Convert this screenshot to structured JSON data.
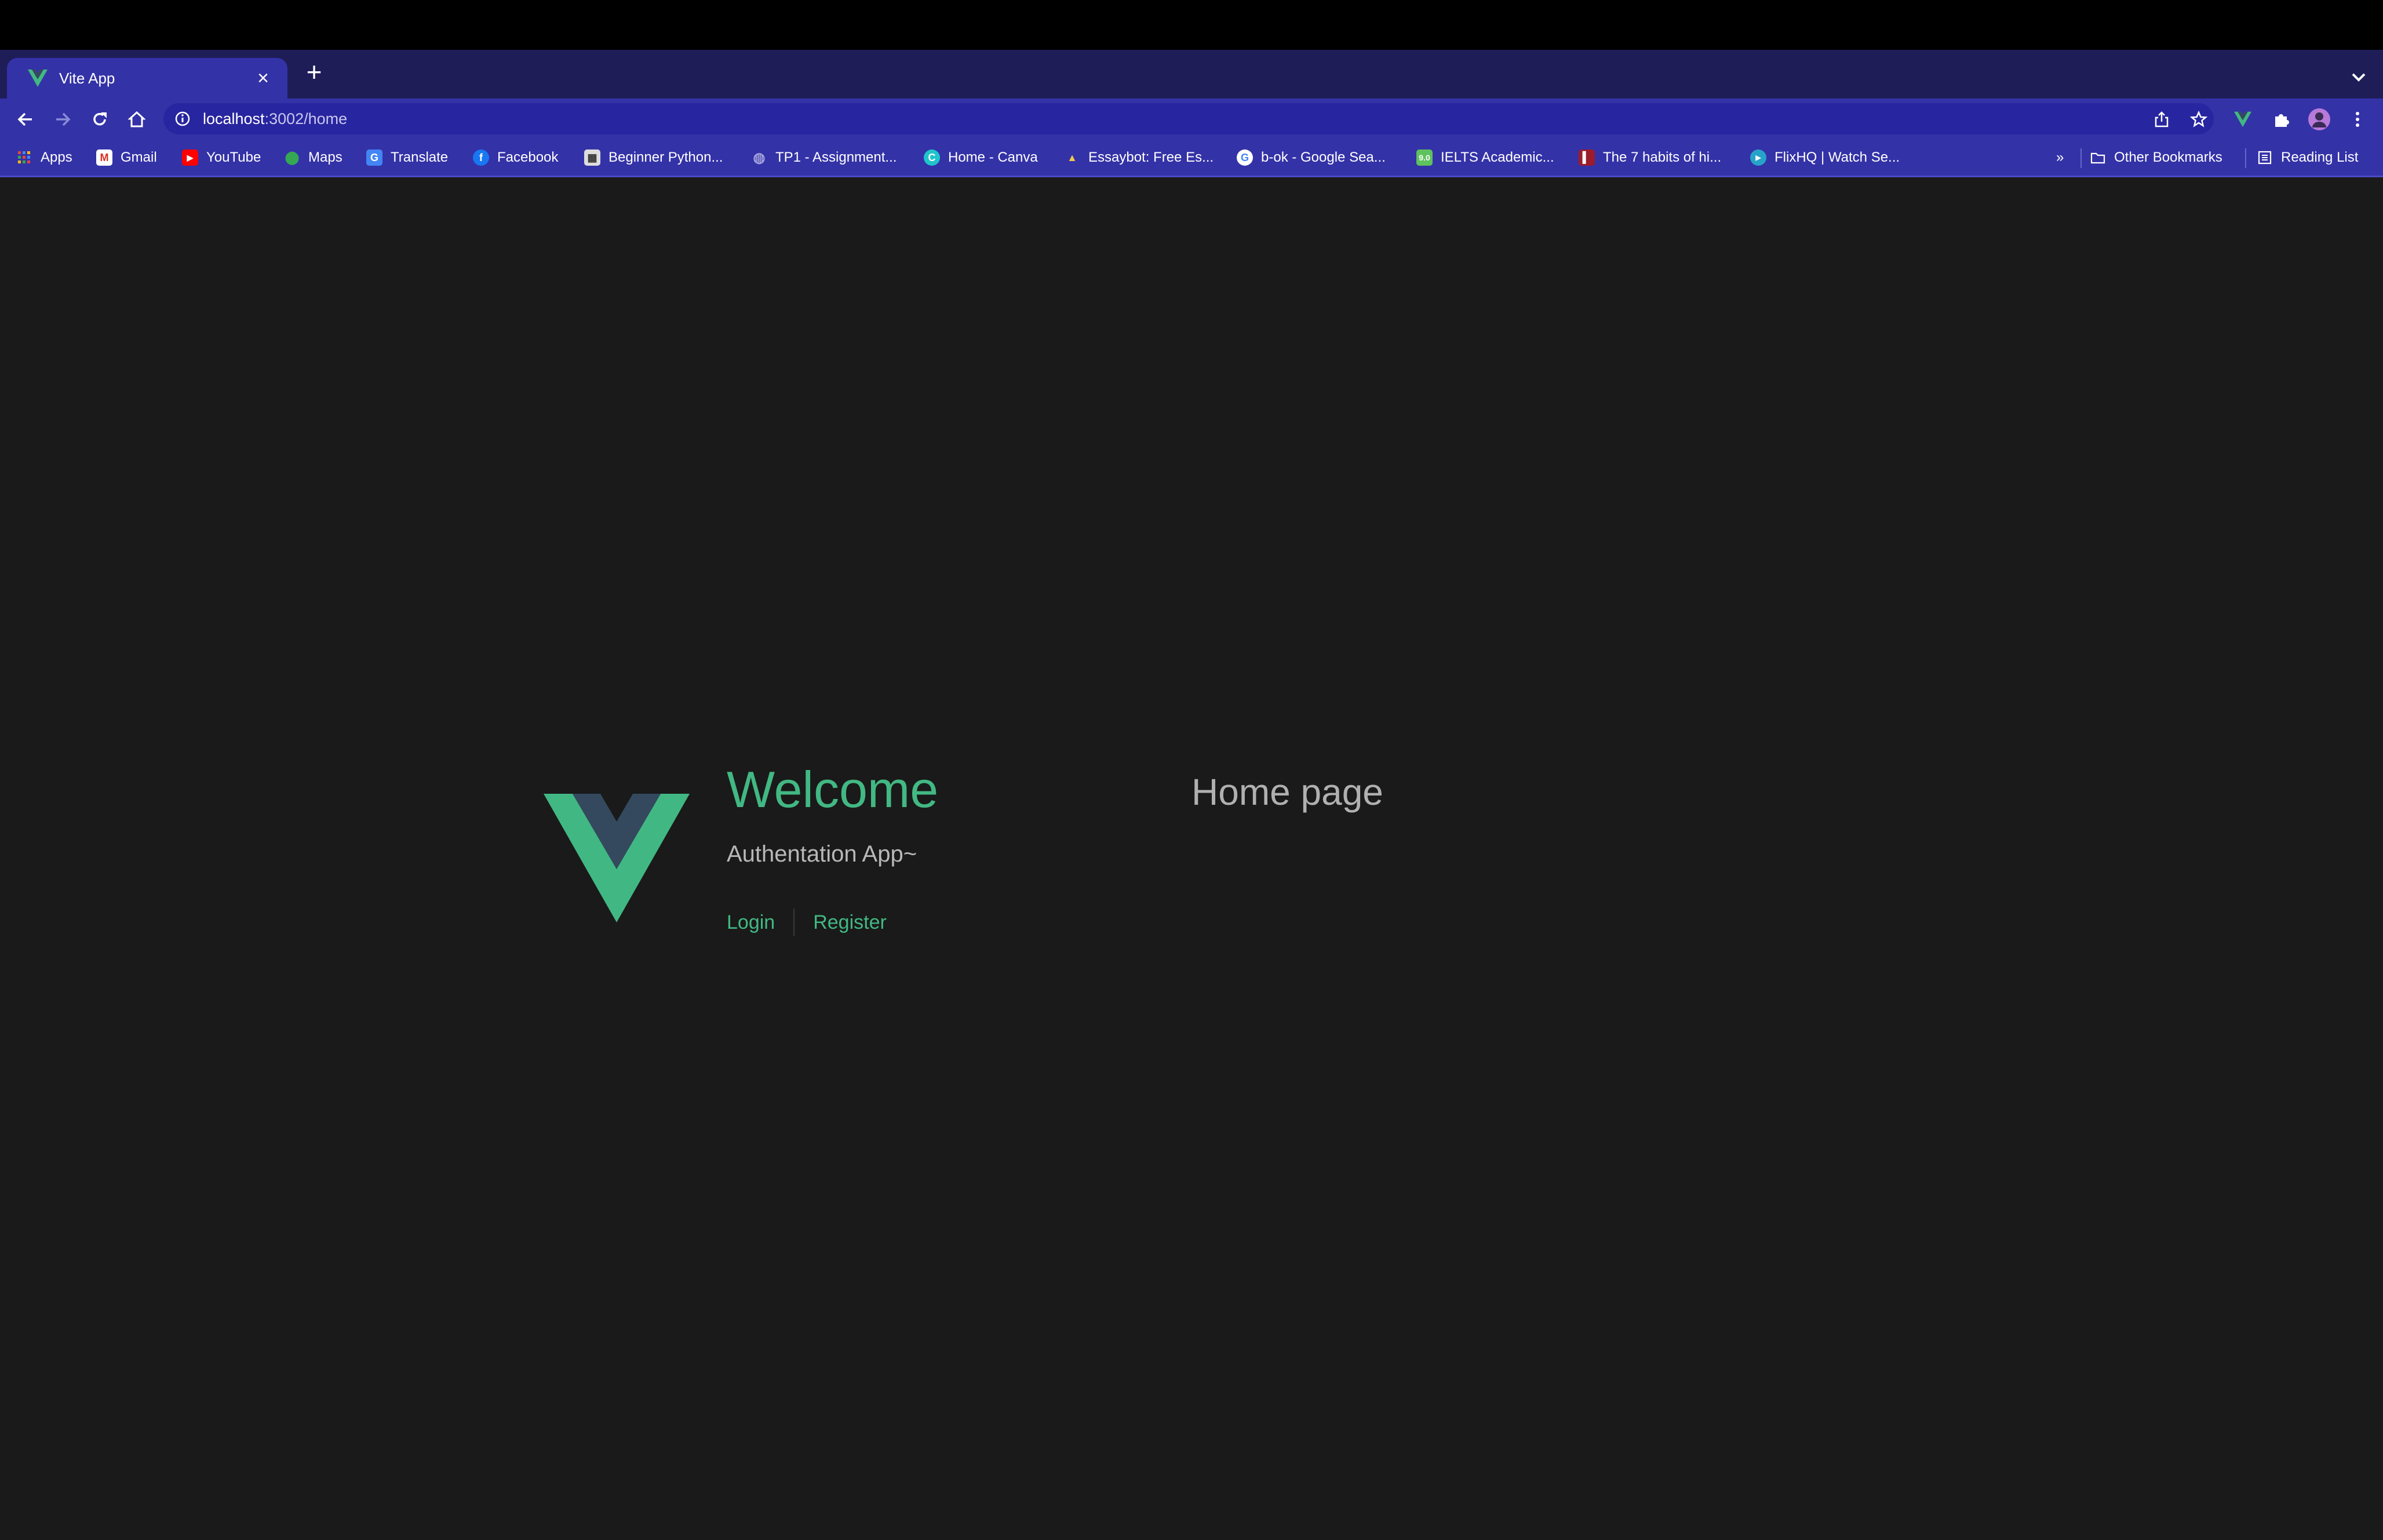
{
  "browser": {
    "tab_title": "Vite App",
    "tab_close": "×",
    "new_tab": "+",
    "url_host": "localhost",
    "url_rest": ":3002/home",
    "bookmarks": [
      {
        "label": "Apps",
        "icon": "apps-grid-icon"
      },
      {
        "label": "Gmail",
        "icon": "gmail-icon"
      },
      {
        "label": "YouTube",
        "icon": "youtube-icon"
      },
      {
        "label": "Maps",
        "icon": "maps-icon"
      },
      {
        "label": "Translate",
        "icon": "translate-icon"
      },
      {
        "label": "Facebook",
        "icon": "facebook-icon"
      },
      {
        "label": "Beginner Python...",
        "icon": "python-icon"
      },
      {
        "label": "TP1 - Assignment...",
        "icon": "globe-icon"
      },
      {
        "label": "Home - Canva",
        "icon": "canva-icon"
      },
      {
        "label": "Essaybot: Free Es...",
        "icon": "essaybot-icon"
      },
      {
        "label": "b-ok - Google Sea...",
        "icon": "google-icon"
      },
      {
        "label": "IELTS Academic...",
        "icon": "ielts-icon"
      },
      {
        "label": "The 7 habits of hi...",
        "icon": "book-icon"
      },
      {
        "label": "FlixHQ | Watch Se...",
        "icon": "flixhq-icon"
      }
    ],
    "overflow": "»",
    "other_bookmarks": "Other Bookmarks",
    "reading_list": "Reading List"
  },
  "page": {
    "welcome": "Welcome",
    "subtitle": "Authentation App~",
    "nav": {
      "login": "Login",
      "register": "Register"
    },
    "heading": "Home page"
  },
  "colors": {
    "accent": "#42b883",
    "background": "#1a1a1a",
    "browser_frame": "#3432a7"
  }
}
